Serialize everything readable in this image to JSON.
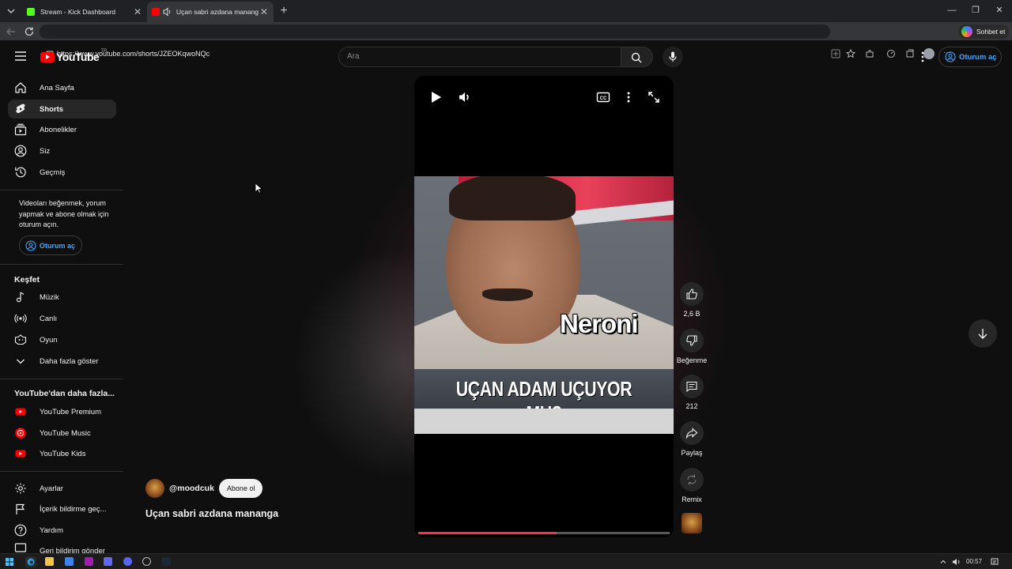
{
  "browser": {
    "tabs": [
      {
        "title": "Stream - Kick Dashboard",
        "favicon_color": "#53fc18"
      },
      {
        "title": "Uçan sabri azdana mananga",
        "favicon_color": "#ff0000"
      }
    ],
    "url": "https://www.youtube.com/shorts/JZEOKqwoNQc",
    "copilot_label": "Sohbet et"
  },
  "header": {
    "logo_text": "YouTube",
    "country_code": "TR",
    "search_placeholder": "Ara",
    "signin_label": "Oturum aç"
  },
  "sidebar": {
    "main_items": [
      {
        "label": "Ana Sayfa",
        "icon": "home-icon"
      },
      {
        "label": "Shorts",
        "icon": "shorts-icon",
        "active": true
      },
      {
        "label": "Abonelikler",
        "icon": "subscriptions-icon"
      },
      {
        "label": "Siz",
        "icon": "user-icon"
      },
      {
        "label": "Geçmiş",
        "icon": "history-icon"
      }
    ],
    "signin_note": "Videoları beğenmek, yorum yapmak ve abone olmak için oturum açın.",
    "signin_label": "Oturum aç",
    "explore_heading": "Keşfet",
    "explore_items": [
      {
        "label": "Müzik",
        "icon": "music-icon"
      },
      {
        "label": "Canlı",
        "icon": "live-icon"
      },
      {
        "label": "Oyun",
        "icon": "gaming-icon"
      },
      {
        "label": "Daha fazla göster",
        "icon": "chevron-down-icon"
      }
    ],
    "more_heading": "YouTube'dan daha fazla...",
    "more_items": [
      {
        "label": "YouTube Premium",
        "icon": "youtube-premium-icon"
      },
      {
        "label": "YouTube Music",
        "icon": "youtube-music-icon"
      },
      {
        "label": "YouTube Kids",
        "icon": "youtube-kids-icon"
      }
    ],
    "footer_items": [
      {
        "label": "Ayarlar",
        "icon": "gear-icon"
      },
      {
        "label": "İçerik bildirme geç...",
        "icon": "flag-icon"
      },
      {
        "label": "Yardım",
        "icon": "help-icon"
      },
      {
        "label": "Geri bildirim gönder",
        "icon": "feedback-icon"
      }
    ]
  },
  "short": {
    "overlay_text": "Neroni",
    "banner_text": "UÇAN ADAM UÇUYOR MU?",
    "progress": 0.55,
    "channel_handle": "@moodcuk",
    "subscribe_label": "Abone ol",
    "title": "Uçan sabri azdana mananga"
  },
  "actions": {
    "likes": "2,6 B",
    "dislike_label": "Beğenme",
    "comments": "212",
    "share_label": "Paylaş",
    "remix_label": "Remix"
  },
  "taskbar": {
    "time": "00:57"
  },
  "colors": {
    "accent_blue": "#3ea6ff",
    "youtube_red": "#ff0000",
    "progress_red": "#ff2d55",
    "background": "#0f0f0f"
  }
}
